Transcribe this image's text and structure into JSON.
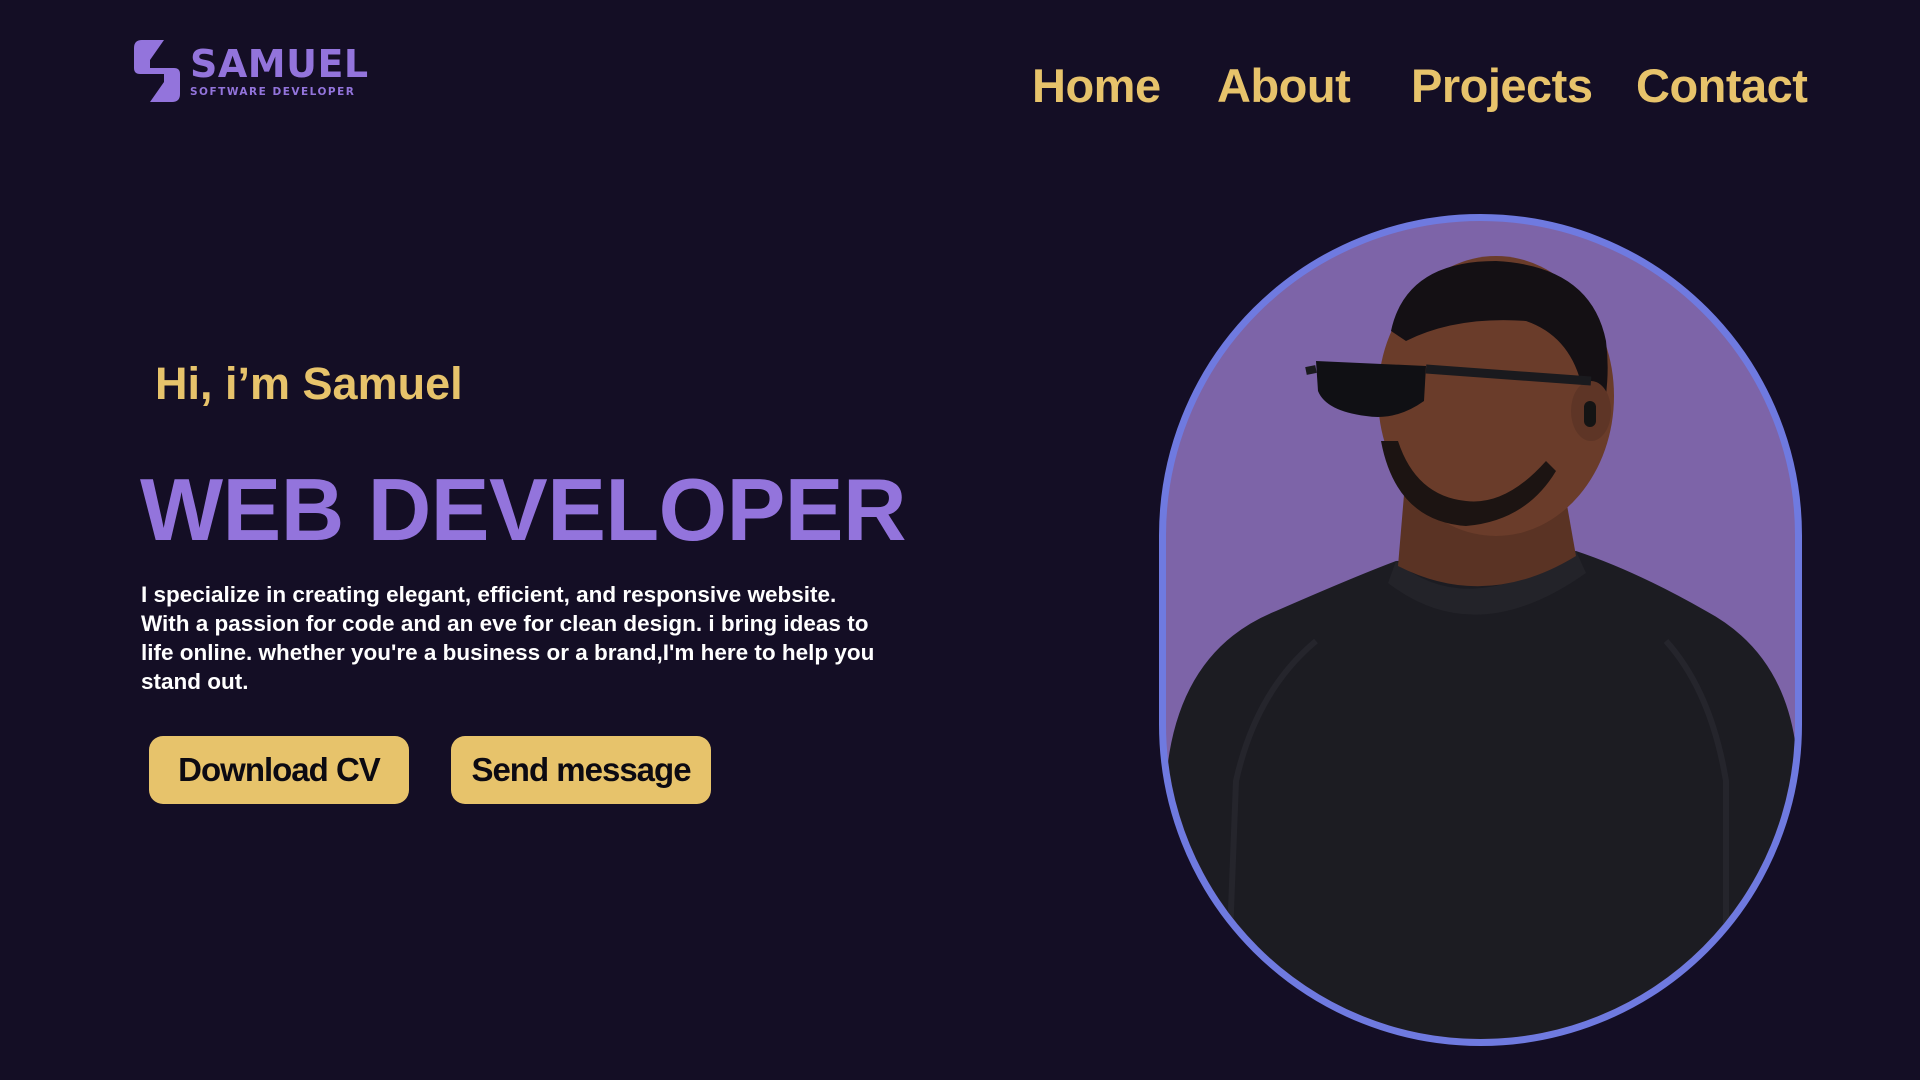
{
  "brand": {
    "name": "SAMUEL",
    "tagline": "SOFTWARE DEVELOPER",
    "logo_icon": "s-monogram-icon",
    "color": "#9374dc"
  },
  "nav": {
    "items": [
      {
        "label": "Home"
      },
      {
        "label": "About"
      },
      {
        "label": "Projects"
      },
      {
        "label": "Contact"
      }
    ],
    "color": "#e7c36b"
  },
  "hero": {
    "greeting": "Hi, i’m Samuel",
    "role": "WEB DEVELOPER",
    "bio": "I specialize in creating elegant, efficient, and responsive website. With a passion for code and an eve for clean design. i bring ideas to life online. whether you're a business or a brand,I'm here to help you stand out.",
    "buttons": {
      "download_cv": "Download CV",
      "send_message": "Send message"
    }
  },
  "portrait": {
    "background": "#7d64a8",
    "border": "#6f7ae0"
  },
  "theme": {
    "page_background": "#140e25",
    "accent_gold": "#e7c36b",
    "accent_purple": "#9374dc"
  }
}
